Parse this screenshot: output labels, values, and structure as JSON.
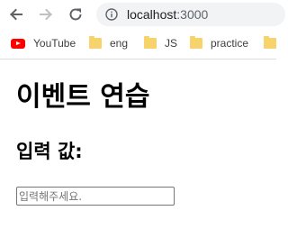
{
  "browser": {
    "url_host": "localhost",
    "url_port": ":3000",
    "bookmarks": [
      {
        "label": "YouTube",
        "icon": "youtube-icon"
      },
      {
        "label": "eng",
        "icon": "folder-icon"
      },
      {
        "label": "JS",
        "icon": "folder-icon"
      },
      {
        "label": "practice",
        "icon": "folder-icon"
      },
      {
        "label": "",
        "icon": "folder-icon"
      }
    ]
  },
  "page": {
    "title": "이벤트 연습",
    "subtitle": "입력 값:",
    "input_placeholder": "입력해주세요."
  }
}
